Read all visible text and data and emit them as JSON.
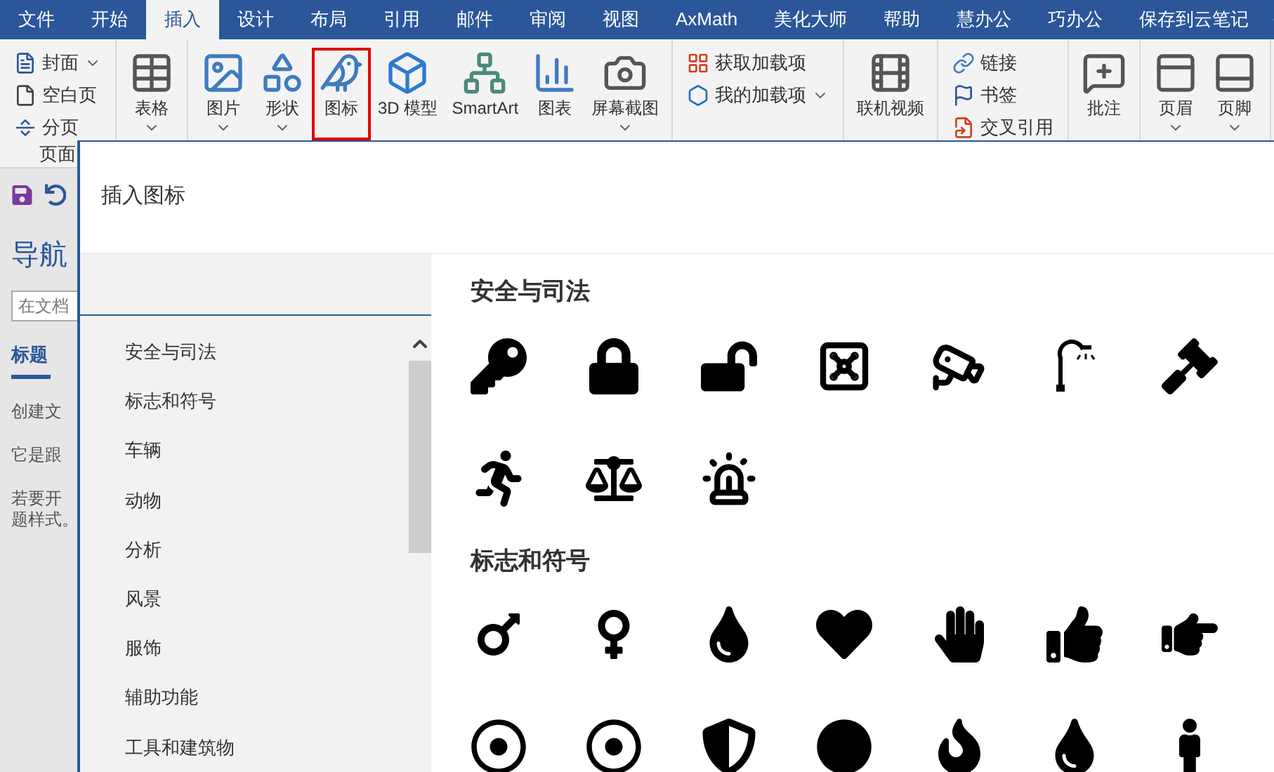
{
  "tabs": [
    {
      "label": "文件",
      "selected": false
    },
    {
      "label": "开始",
      "selected": false
    },
    {
      "label": "插入",
      "selected": true
    },
    {
      "label": "设计",
      "selected": false
    },
    {
      "label": "布局",
      "selected": false
    },
    {
      "label": "引用",
      "selected": false
    },
    {
      "label": "邮件",
      "selected": false
    },
    {
      "label": "审阅",
      "selected": false
    },
    {
      "label": "视图",
      "selected": false
    },
    {
      "label": "AxMath",
      "selected": false
    },
    {
      "label": "美化大师",
      "selected": false
    },
    {
      "label": "帮助",
      "selected": false
    },
    {
      "label": "慧办公",
      "selected": false
    },
    {
      "label": "巧办公",
      "selected": false
    },
    {
      "label": "保存到云笔记",
      "selected": false
    }
  ],
  "ribbon_groups": [
    {
      "label": "页面",
      "items": [
        {
          "label": "封面",
          "kind": "small",
          "dropdown": true,
          "highlighted": false
        },
        {
          "label": "空白页",
          "kind": "small",
          "dropdown": false,
          "highlighted": false
        },
        {
          "label": "分页",
          "kind": "small",
          "dropdown": false,
          "highlighted": false
        }
      ]
    },
    {
      "items": [
        {
          "label": "表格",
          "kind": "large",
          "dropdown": true,
          "highlighted": false
        }
      ]
    },
    {
      "items": [
        {
          "label": "图片",
          "kind": "large",
          "dropdown": true,
          "highlighted": false
        },
        {
          "label": "形状",
          "kind": "large",
          "dropdown": true,
          "highlighted": false
        },
        {
          "label": "图标",
          "kind": "large",
          "dropdown": false,
          "highlighted": true
        },
        {
          "label": "3D 模型",
          "kind": "large",
          "dropdown": false,
          "highlighted": false
        },
        {
          "label": "SmartArt",
          "kind": "large",
          "dropdown": false,
          "highlighted": false
        },
        {
          "label": "图表",
          "kind": "large",
          "dropdown": false,
          "highlighted": false
        },
        {
          "label": "屏幕截图",
          "kind": "large",
          "dropdown": true,
          "highlighted": false
        }
      ]
    },
    {
      "items": [
        {
          "label": "获取加载项",
          "kind": "small",
          "dropdown": false,
          "highlighted": false
        },
        {
          "label": "我的加载项",
          "kind": "small",
          "dropdown": true,
          "highlighted": false
        }
      ]
    },
    {
      "items": [
        {
          "label": "联机视频",
          "kind": "large",
          "dropdown": false,
          "highlighted": false
        }
      ]
    },
    {
      "items": [
        {
          "label": "链接",
          "kind": "small",
          "dropdown": false,
          "highlighted": false
        },
        {
          "label": "书签",
          "kind": "small",
          "dropdown": false,
          "highlighted": false
        },
        {
          "label": "交叉引用",
          "kind": "small",
          "dropdown": false,
          "highlighted": false
        }
      ]
    },
    {
      "items": [
        {
          "label": "批注",
          "kind": "large",
          "dropdown": false,
          "highlighted": false
        }
      ]
    },
    {
      "items": [
        {
          "label": "页眉",
          "kind": "large",
          "dropdown": true,
          "highlighted": false
        },
        {
          "label": "页脚",
          "kind": "large",
          "dropdown": true,
          "highlighted": false
        }
      ]
    }
  ],
  "nav_pane": {
    "title": "导航",
    "search": {
      "placeholder": "在文档"
    },
    "tabs": [
      {
        "label": "标题",
        "selected": true
      }
    ],
    "texts": [
      "创建文",
      "它是跟",
      "若要开",
      "题样式。"
    ]
  },
  "dialog": {
    "title": "插入图标",
    "categories": [
      {
        "label": "安全与司法",
        "selected": false
      },
      {
        "label": "标志和符号",
        "selected": false
      },
      {
        "label": "车辆",
        "selected": false
      },
      {
        "label": "动物",
        "selected": false
      },
      {
        "label": "分析",
        "selected": false
      },
      {
        "label": "风景",
        "selected": false
      },
      {
        "label": "服饰",
        "selected": false
      },
      {
        "label": "辅助功能",
        "selected": false
      },
      {
        "label": "工具和建筑物",
        "selected": false
      }
    ],
    "sections": [
      {
        "title": "安全与司法",
        "icons": [
          {
            "kind": "key"
          },
          {
            "kind": "lock"
          },
          {
            "kind": "unlock"
          },
          {
            "kind": "safe"
          },
          {
            "kind": "camera"
          },
          {
            "kind": "lamp"
          },
          {
            "kind": "gavel"
          },
          {
            "kind": "thief"
          },
          {
            "kind": "scales"
          },
          {
            "kind": "siren"
          }
        ]
      },
      {
        "title": "标志和符号",
        "icons": [
          {
            "kind": "male"
          },
          {
            "kind": "female"
          },
          {
            "kind": "drop"
          },
          {
            "kind": "heart"
          },
          {
            "kind": "hand"
          },
          {
            "kind": "thumb"
          },
          {
            "kind": "point"
          },
          {
            "kind": "ring"
          },
          {
            "kind": "ring"
          },
          {
            "kind": "shield"
          },
          {
            "kind": "dot"
          },
          {
            "kind": "fire"
          },
          {
            "kind": "drop"
          },
          {
            "kind": "person"
          }
        ]
      }
    ]
  }
}
